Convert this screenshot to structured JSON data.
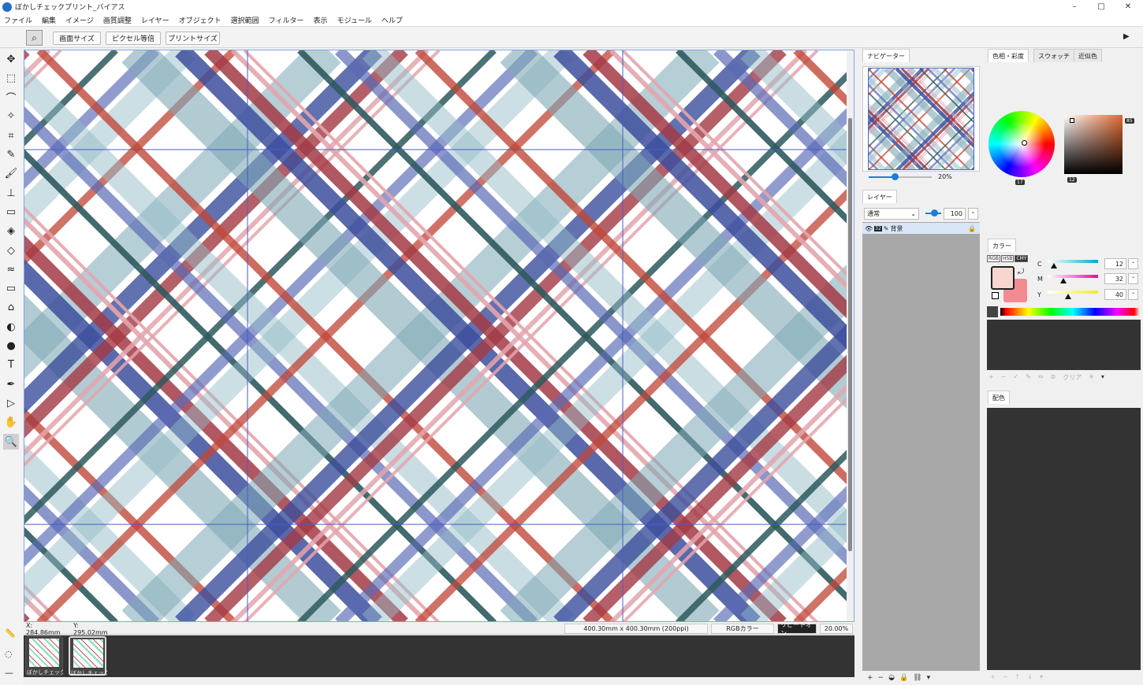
{
  "window": {
    "title": "ぼかしチェックプリント_バイアス",
    "controls": {
      "minimize": "–",
      "maximize": "□",
      "close": "✕"
    }
  },
  "menu": [
    "ファイル",
    "編集",
    "イメージ",
    "画質調整",
    "レイヤー",
    "オブジェクト",
    "選択範囲",
    "フィルター",
    "表示",
    "モジュール",
    "ヘルプ"
  ],
  "toolbar": {
    "fit_screen": "画面サイズ",
    "pixel_1x": "ピクセル等倍",
    "print_size": "プリントサイズ",
    "expand_icon": "▶"
  },
  "tools": [
    {
      "name": "move-icon",
      "glyph": "✥"
    },
    {
      "name": "rect-select-icon",
      "glyph": "⬚"
    },
    {
      "name": "lasso-icon",
      "glyph": "⌒"
    },
    {
      "name": "magic-wand-icon",
      "glyph": "✧"
    },
    {
      "name": "crop-icon",
      "glyph": "⌗"
    },
    {
      "name": "eyedropper-icon",
      "glyph": "✎"
    },
    {
      "name": "brush-icon",
      "glyph": "🖌"
    },
    {
      "name": "stamp-icon",
      "glyph": "⊥"
    },
    {
      "name": "eraser-icon",
      "glyph": "▭"
    },
    {
      "name": "fill-icon",
      "glyph": "◈"
    },
    {
      "name": "gradient-fill-icon",
      "glyph": "◇"
    },
    {
      "name": "pattern-icon",
      "glyph": "≈"
    },
    {
      "name": "shape-icon",
      "glyph": "▭"
    },
    {
      "name": "blur-icon",
      "glyph": "⌂"
    },
    {
      "name": "drop-icon",
      "glyph": "◐"
    },
    {
      "name": "dodge-icon",
      "glyph": "●"
    },
    {
      "name": "text-icon",
      "glyph": "T"
    },
    {
      "name": "pen-icon",
      "glyph": "✒"
    },
    {
      "name": "path-select-icon",
      "glyph": "▷"
    },
    {
      "name": "hand-icon",
      "glyph": "✋"
    },
    {
      "name": "zoom-icon",
      "glyph": "🔍"
    }
  ],
  "status": {
    "x": "X: 284.86mm",
    "y": "Y: 295.02mm",
    "doc_size": "400.30mm x 400.30mm (200ppi)",
    "color_mode": "RGBカラー",
    "repeat": "リピートオン",
    "zoom": "20.00%"
  },
  "documents": [
    {
      "label": "ぼかしチェックプ..."
    },
    {
      "label": "ぼかしチェック"
    }
  ],
  "navigator": {
    "tab": "ナビゲーター",
    "zoom": "20%",
    "zoom_fraction": 0.2
  },
  "layers": {
    "tab": "レイヤー",
    "blend_mode": "通常",
    "opacity": "100",
    "layer_name": "背景",
    "bit_depth": "32",
    "spin_icon": "⌃"
  },
  "color_panel": {
    "tabs": [
      "色相・彩度",
      "スウォッチ",
      "近似色"
    ],
    "hue_badge": "17",
    "value_badge": "12",
    "sat_badge": "85",
    "section": "カラー",
    "modes": [
      "RGB",
      "HSB",
      "CMY"
    ],
    "sliders": [
      {
        "label": "C",
        "value": "12",
        "fraction": 0.12
      },
      {
        "label": "M",
        "value": "32",
        "fraction": 0.32
      },
      {
        "label": "Y",
        "value": "40",
        "fraction": 0.4
      }
    ],
    "swatch_tools": [
      "+",
      "−",
      "✓",
      "✎",
      "⇔",
      "⊘",
      "クリア",
      "✳",
      "▾"
    ]
  },
  "harmony": {
    "tab": "配色",
    "tools": [
      "+",
      "−",
      "↑",
      "↓",
      "▾"
    ]
  },
  "colors": {
    "accent": "#1c7fd6",
    "fg": "#f7d6cf",
    "bg": "#f28a92"
  }
}
